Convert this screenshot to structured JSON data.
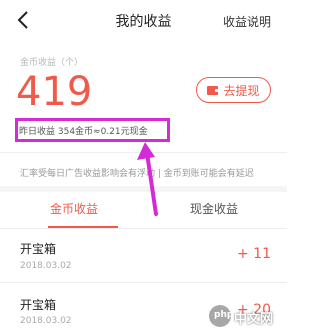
{
  "header": {
    "title": "我的收益",
    "help_label": "收益说明"
  },
  "balance": {
    "label": "金币收益（个）",
    "value": "419"
  },
  "withdraw": {
    "label": "去提现"
  },
  "yesterday": {
    "text": "昨日收益 354金币≈0.21元现金"
  },
  "notice": {
    "text": "汇率受每日广告收益影响会有浮动 | 金币到账可能会有延迟"
  },
  "tabs": [
    {
      "label": "金币收益",
      "active": true
    },
    {
      "label": "现金收益",
      "active": false
    }
  ],
  "records": [
    {
      "title": "开宝箱",
      "date": "2018.03.02",
      "amount": "+ 11"
    },
    {
      "title": "开宝箱",
      "date": "2018.03.02",
      "amount": "+ 20"
    }
  ],
  "watermark": {
    "logo_text": "php",
    "text": "中文网"
  },
  "colors": {
    "accent": "#ef5a4b",
    "highlight": "#d52bd6"
  }
}
